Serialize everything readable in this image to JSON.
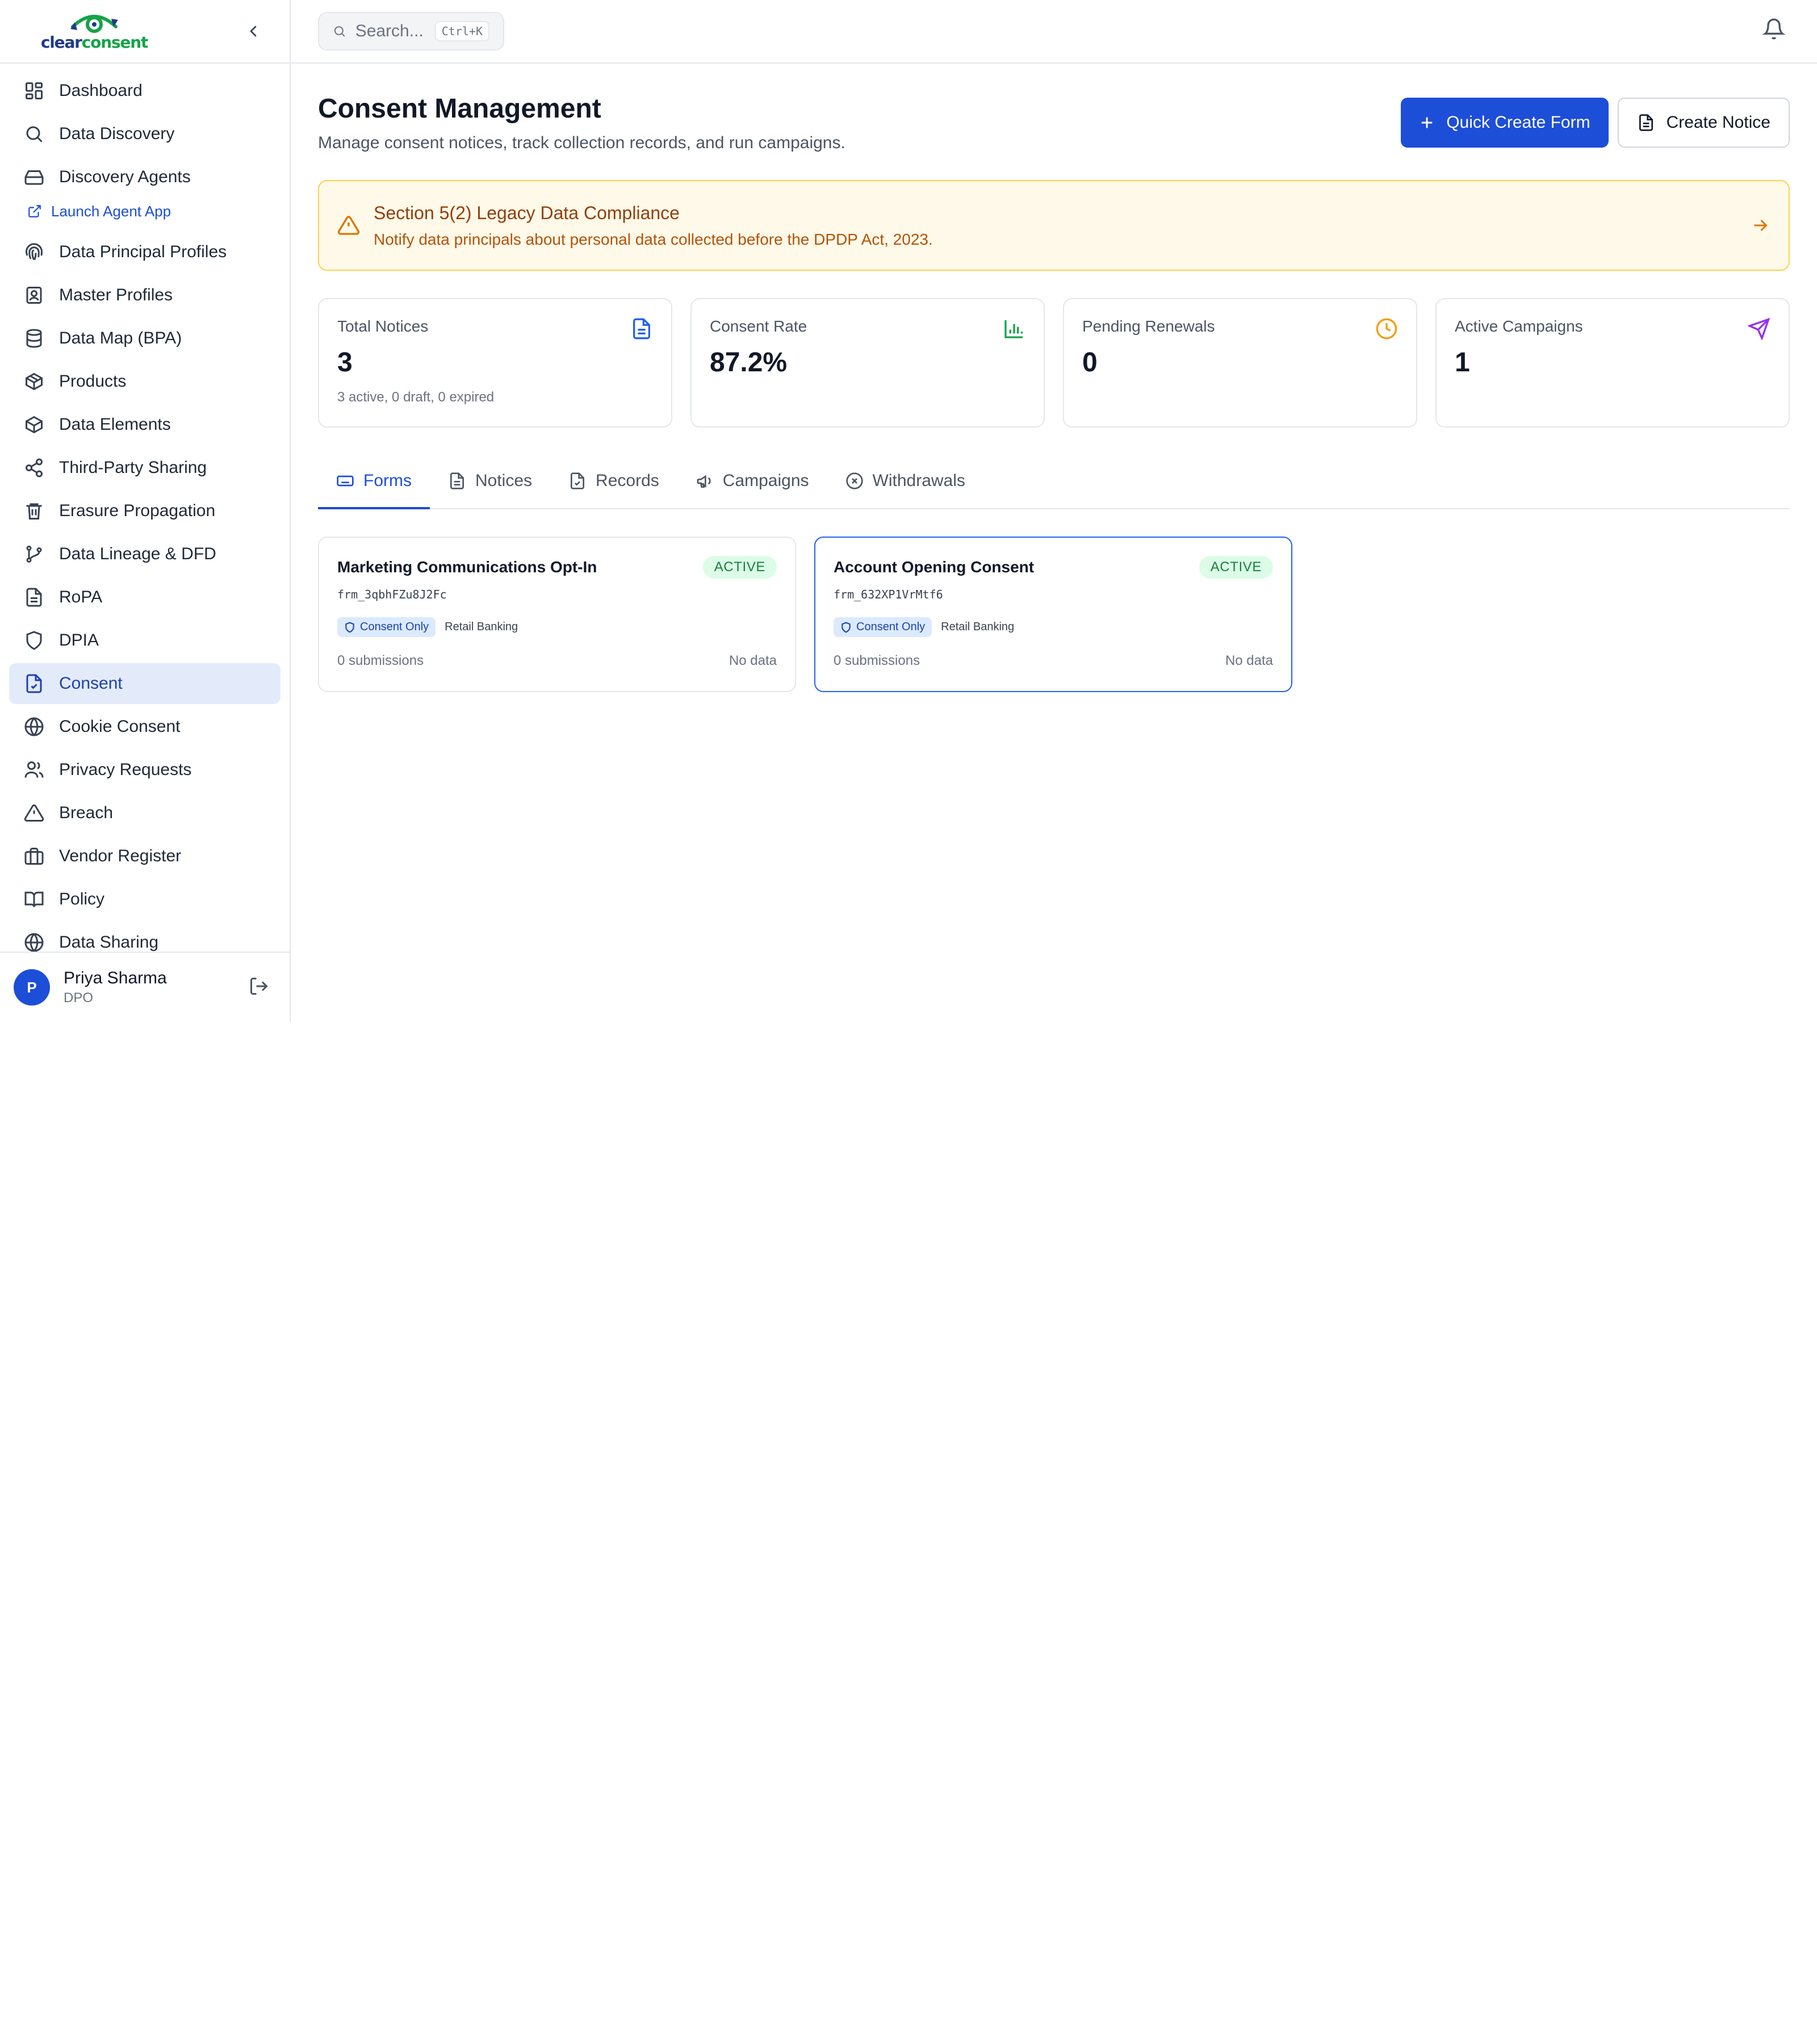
{
  "brand": {
    "logo_text_1": "clear",
    "logo_text_2": "consent"
  },
  "sidebar": {
    "items": [
      {
        "label": "Dashboard",
        "icon": "grid-icon"
      },
      {
        "label": "Data Discovery",
        "icon": "search-icon"
      },
      {
        "label": "Discovery Agents",
        "icon": "hard-drive-icon"
      },
      {
        "label": "Data Principal Profiles",
        "icon": "fingerprint-icon"
      },
      {
        "label": "Master Profiles",
        "icon": "contact-icon"
      },
      {
        "label": "Data Map (BPA)",
        "icon": "database-icon"
      },
      {
        "label": "Products",
        "icon": "package-icon"
      },
      {
        "label": "Data Elements",
        "icon": "box-icon"
      },
      {
        "label": "Third-Party Sharing",
        "icon": "share-icon"
      },
      {
        "label": "Erasure Propagation",
        "icon": "trash-icon"
      },
      {
        "label": "Data Lineage & DFD",
        "icon": "git-branch-icon"
      },
      {
        "label": "RoPA",
        "icon": "file-text-icon"
      },
      {
        "label": "DPIA",
        "icon": "shield-icon"
      },
      {
        "label": "Consent",
        "icon": "file-check-icon"
      },
      {
        "label": "Cookie Consent",
        "icon": "globe-icon"
      },
      {
        "label": "Privacy Requests",
        "icon": "users-icon"
      },
      {
        "label": "Breach",
        "icon": "alert-triangle-icon"
      },
      {
        "label": "Vendor Register",
        "icon": "briefcase-icon"
      },
      {
        "label": "Policy",
        "icon": "book-icon"
      },
      {
        "label": "Data Sharing",
        "icon": "globe-icon"
      }
    ],
    "sub_link": "Launch Agent App",
    "active": "Consent"
  },
  "user": {
    "initial": "P",
    "name": "Priya Sharma",
    "role": "DPO"
  },
  "topbar": {
    "search_placeholder": "Search...",
    "shortcut": "Ctrl+K"
  },
  "page": {
    "title": "Consent Management",
    "subtitle": "Manage consent notices, track collection records, and run campaigns.",
    "primary_action": "Quick Create Form",
    "secondary_action": "Create Notice"
  },
  "alert": {
    "title": "Section 5(2) Legacy Data Compliance",
    "description": "Notify data principals about personal data collected before the DPDP Act, 2023."
  },
  "stats": [
    {
      "label": "Total Notices",
      "value": "3",
      "sub": "3 active, 0 draft, 0 expired",
      "icon": "file-icon",
      "color": "#2563eb"
    },
    {
      "label": "Consent Rate",
      "value": "87.2%",
      "sub": "",
      "icon": "bar-chart-icon",
      "color": "#16a34a"
    },
    {
      "label": "Pending Renewals",
      "value": "0",
      "sub": "",
      "icon": "clock-icon",
      "color": "#f59e0b"
    },
    {
      "label": "Active Campaigns",
      "value": "1",
      "sub": "",
      "icon": "send-icon",
      "color": "#9333ea"
    }
  ],
  "tabs": [
    {
      "label": "Forms",
      "active": true
    },
    {
      "label": "Notices"
    },
    {
      "label": "Records"
    },
    {
      "label": "Campaigns"
    },
    {
      "label": "Withdrawals"
    }
  ],
  "forms": [
    {
      "title": "Marketing Communications Opt-In",
      "status": "ACTIVE",
      "id": "frm_3qbhFZu8J2Fc",
      "tag": "Consent Only",
      "org": "Retail Banking",
      "submissions": "0 submissions",
      "data": "No data"
    },
    {
      "title": "Account Opening Consent",
      "status": "ACTIVE",
      "id": "frm_632XP1VrMtf6",
      "tag": "Consent Only",
      "org": "Retail Banking",
      "submissions": "0 submissions",
      "data": "No data"
    }
  ],
  "colors": {
    "accent": "#1d4ed8",
    "active_bg": "#e3ebfb",
    "warning_bg": "#fef9e8",
    "warning_text": "#92400e"
  }
}
